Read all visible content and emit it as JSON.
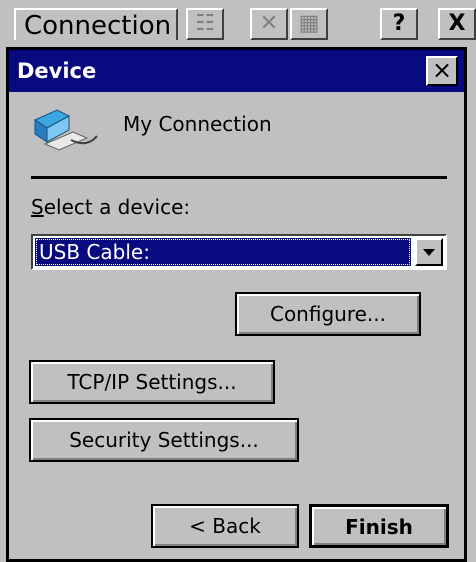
{
  "parent_window": {
    "tab_label": "Connection",
    "help_label": "?",
    "close_label": "X"
  },
  "dialog": {
    "title": "Device",
    "close_label": "×",
    "connection_name": "My Connection",
    "select_label": "Select a device:",
    "select_label_mnemonic": "S",
    "selected_device": "USB Cable:",
    "buttons": {
      "configure": "Configure...",
      "tcpip": "TCP/IP Settings...",
      "security": "Security Settings...",
      "back": "< Back",
      "finish": "Finish"
    }
  },
  "colors": {
    "titlebar": "#0a0a80",
    "face": "#c0c0c0",
    "selection": "#0a0a80"
  }
}
